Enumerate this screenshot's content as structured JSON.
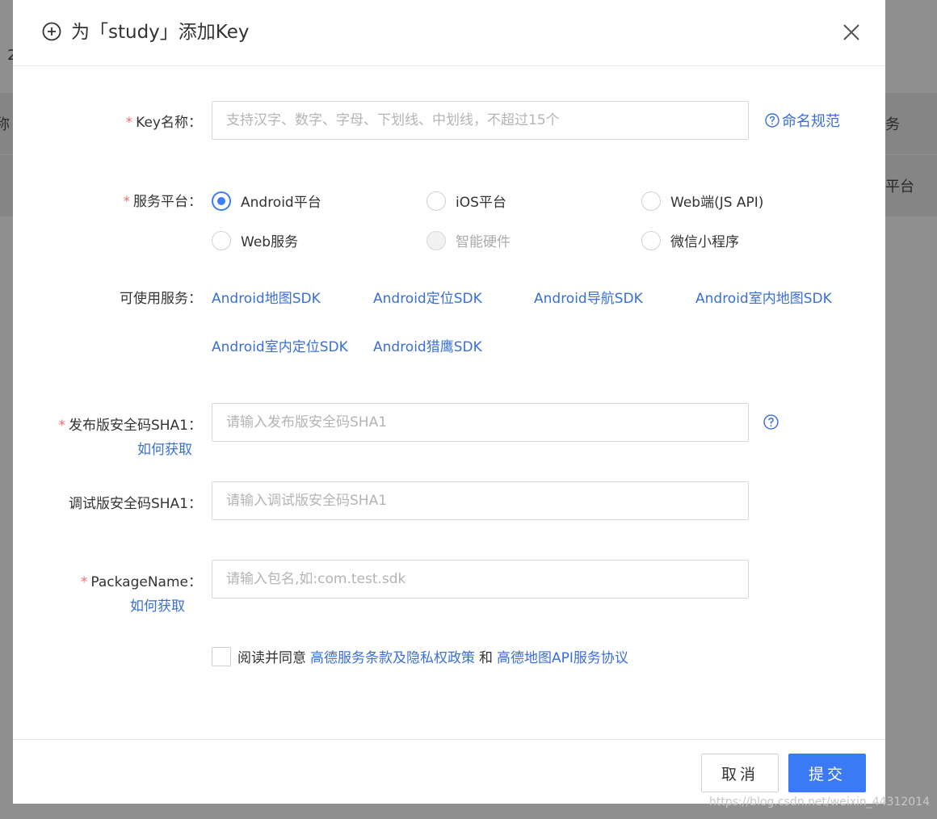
{
  "background": {
    "frag_left_top": "2",
    "frag_left_mid": "称",
    "frag_right_mid": "务",
    "frag_right_row": "平台"
  },
  "modal": {
    "title": "为「study」添加Key",
    "key_name": {
      "label": "Key名称",
      "placeholder": "支持汉字、数字、字母、下划线、中划线，不超过15个",
      "help_link": "命名规范"
    },
    "platform": {
      "label": "服务平台",
      "options": [
        {
          "label": "Android平台",
          "checked": true,
          "disabled": false
        },
        {
          "label": "iOS平台",
          "checked": false,
          "disabled": false
        },
        {
          "label": "Web端(JS API)",
          "checked": false,
          "disabled": false
        },
        {
          "label": "Web服务",
          "checked": false,
          "disabled": false
        },
        {
          "label": "智能硬件",
          "checked": false,
          "disabled": true
        },
        {
          "label": "微信小程序",
          "checked": false,
          "disabled": false
        }
      ]
    },
    "services": {
      "label": "可使用服务",
      "items": [
        "Android地图SDK",
        "Android定位SDK",
        "Android导航SDK",
        "Android室内地图SDK",
        "Android室内定位SDK",
        "Android猎鹰SDK"
      ]
    },
    "release_sha1": {
      "label": "发布版安全码SHA1",
      "how_to": "如何获取",
      "placeholder": "请输入发布版安全码SHA1"
    },
    "debug_sha1": {
      "label": "调试版安全码SHA1",
      "placeholder": "请输入调试版安全码SHA1"
    },
    "package_name": {
      "label": "PackageName",
      "how_to": "如何获取",
      "placeholder": "请输入包名,如:com.test.sdk"
    },
    "agreement": {
      "prefix": "阅读并同意",
      "link1": "高德服务条款及隐私权政策",
      "and": "和",
      "link2": "高德地图API服务协议"
    },
    "footer": {
      "cancel": "取消",
      "submit": "提交"
    }
  },
  "watermark": "https://blog.csdn.net/weixin_44312014",
  "colors": {
    "accent": "#3b7af5",
    "link": "#3a6fd8",
    "required": "#f56c6c",
    "overlay": "#8f8f8f"
  }
}
